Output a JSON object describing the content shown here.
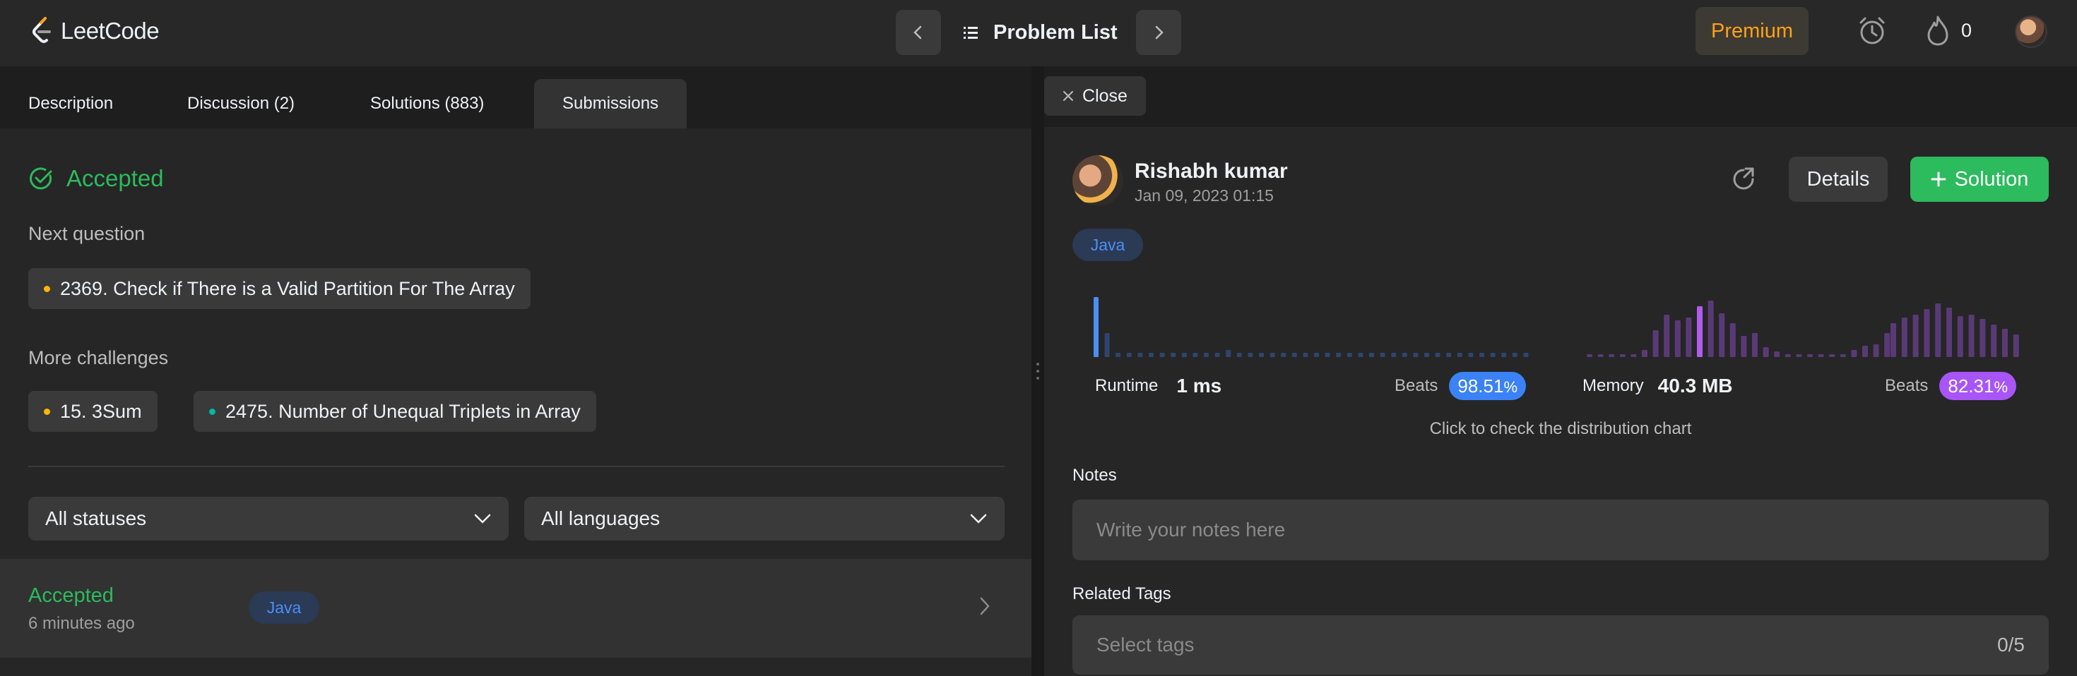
{
  "app": {
    "logo_text": "LeetCode"
  },
  "topbar": {
    "problem_list_label": "Problem List",
    "premium_label": "Premium",
    "streak_count": "0"
  },
  "left": {
    "tabs": [
      {
        "label": "Description"
      },
      {
        "label": "Discussion (2)"
      },
      {
        "label": "Solutions (883)"
      },
      {
        "label": "Submissions"
      }
    ],
    "result_title": "Accepted",
    "next_question_label": "Next question",
    "next_question": {
      "title": "2369. Check if There is a Valid Partition For The Array",
      "difficulty_color": "#ffb800"
    },
    "more_challenges_label": "More challenges",
    "more_challenges": [
      {
        "title": "15. 3Sum",
        "difficulty_color": "#ffb800"
      },
      {
        "title": "2475. Number of Unequal Triplets in Array",
        "difficulty_color": "#00b8a3"
      }
    ],
    "status_filter": "All statuses",
    "language_filter": "All languages",
    "submission": {
      "status": "Accepted",
      "time": "6 minutes ago",
      "language": "Java"
    }
  },
  "right": {
    "close_label": "Close",
    "user_name": "Rishabh kumar",
    "submitted_at": "Jan 09, 2023 01:15",
    "details_label": "Details",
    "solution_label": "Solution",
    "language": "Java",
    "runtime": {
      "label": "Runtime",
      "value": "1 ms",
      "beats_label": "Beats",
      "beats_int": "98.51",
      "beats_unit": "%"
    },
    "memory": {
      "label": "Memory",
      "value": "40.3 MB",
      "beats_label": "Beats",
      "beats_int": "82.31",
      "beats_unit": "%"
    },
    "chart_hint": "Click to check the distribution chart",
    "notes_label": "Notes",
    "notes_placeholder": "Write your notes here",
    "tags_label": "Related Tags",
    "tags_placeholder": "Select tags",
    "tags_count": "0/5"
  },
  "colors": {
    "accent_green": "#2cbb5d",
    "premium_orange": "#ffa116",
    "runtime_blue": "#4a8ff7",
    "memory_purple": "#b05cf0"
  },
  "runtime_distribution": [
    85,
    34,
    6,
    6,
    6,
    6,
    6,
    6,
    6,
    6,
    6,
    6,
    10,
    6,
    6,
    6,
    6,
    6,
    6,
    6,
    6,
    6,
    6,
    6,
    6,
    6,
    6,
    6,
    6,
    6,
    6,
    6,
    6,
    6,
    6,
    6,
    6,
    6,
    6,
    6
  ],
  "runtime_highlight_index": 0,
  "memory_distribution_left": [
    4,
    4,
    4,
    4,
    4,
    10,
    38,
    60,
    52,
    56,
    72,
    80,
    62,
    48,
    30,
    34,
    14,
    8,
    4,
    4,
    4,
    4,
    4,
    4,
    10,
    16,
    18,
    34
  ],
  "memory_highlight_index": 10,
  "memory_distribution_right": [
    48,
    56,
    60,
    68,
    76,
    70,
    58,
    60,
    54,
    46,
    40,
    32
  ]
}
